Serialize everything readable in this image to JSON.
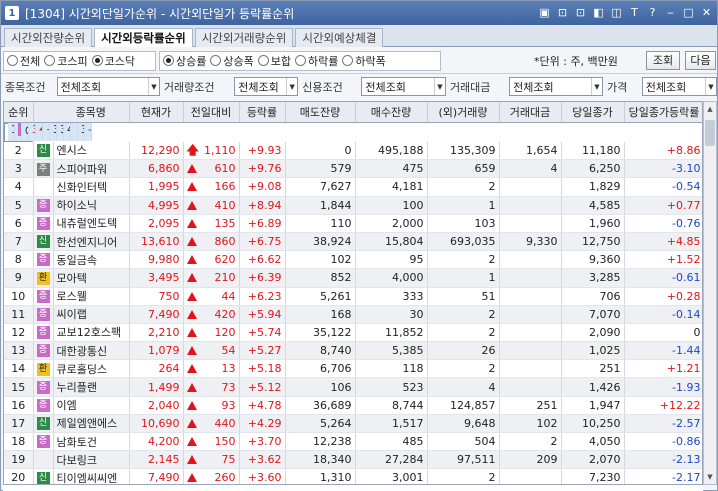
{
  "window": {
    "num": "1",
    "title": "[1304] 시간외단일가순위 - 시간외단일가 등락률순위",
    "tools": [
      "▣",
      "⊡",
      "⊡",
      "◧",
      "◫",
      "T",
      "?",
      "‒",
      "□",
      "✕"
    ]
  },
  "tabs": [
    "시간외잔량순위",
    "시간외등락률순위",
    "시간외거래량순위",
    "시간외예상체결"
  ],
  "active_tab": 1,
  "market_radios": [
    {
      "label": "전체",
      "on": false
    },
    {
      "label": "코스피",
      "on": false
    },
    {
      "label": "코스닥",
      "on": true
    }
  ],
  "change_radios": [
    {
      "label": "상승률",
      "on": true
    },
    {
      "label": "상승폭",
      "on": false
    },
    {
      "label": "보합",
      "on": false
    },
    {
      "label": "하락률",
      "on": false
    },
    {
      "label": "하락폭",
      "on": false
    }
  ],
  "unit_text": "*단위 : 주, 백만원",
  "buttons": {
    "query": "조회",
    "next": "다음"
  },
  "filters": [
    {
      "label": "종목조건",
      "value": "전체조회"
    },
    {
      "label": "거래량조건",
      "value": "전체조회"
    },
    {
      "label": "신용조건",
      "value": "전체조회"
    },
    {
      "label": "거래대금",
      "value": "전체조회"
    },
    {
      "label": "가격",
      "value": "전체조회"
    }
  ],
  "columns": [
    "순위",
    "",
    "종목명",
    "현재가",
    "전일대비",
    "등락률",
    "매도잔량",
    "매수잔량",
    "(외)거래량",
    "거래대금",
    "당일종가",
    "당일종가등락률"
  ],
  "rows": [
    {
      "rank": "1",
      "badge": "증",
      "badge_color": "pink",
      "name": "에프엔씨엔터",
      "price": "3,475",
      "sign": "limit",
      "diff": "315",
      "rate": "+9.97",
      "ask": "398",
      "bid": "301",
      "vol": "4",
      "amt": "",
      "close": "3,160",
      "close_rate": "-1.56",
      "close_dir": "dn"
    },
    {
      "rank": "2",
      "badge": "신",
      "badge_color": "green",
      "name": "엔시스",
      "price": "12,290",
      "sign": "limit",
      "diff": "1,110",
      "rate": "+9.93",
      "ask": "0",
      "bid": "495,188",
      "vol": "135,309",
      "amt": "1,654",
      "close": "11,180",
      "close_rate": "+8.86",
      "close_dir": "up"
    },
    {
      "rank": "3",
      "badge": "주",
      "badge_color": "gray",
      "name": "스피어파워",
      "price": "6,860",
      "sign": "up",
      "diff": "610",
      "rate": "+9.76",
      "ask": "579",
      "bid": "475",
      "vol": "659",
      "amt": "4",
      "close": "6,250",
      "close_rate": "-3.10",
      "close_dir": "dn"
    },
    {
      "rank": "4",
      "badge": "",
      "badge_color": "",
      "name": "신화인터텍",
      "price": "1,995",
      "sign": "up",
      "diff": "166",
      "rate": "+9.08",
      "ask": "7,627",
      "bid": "4,181",
      "vol": "2",
      "amt": "",
      "close": "1,829",
      "close_rate": "-0.54",
      "close_dir": "dn"
    },
    {
      "rank": "5",
      "badge": "증",
      "badge_color": "pink",
      "name": "하이소닉",
      "price": "4,995",
      "sign": "up",
      "diff": "410",
      "rate": "+8.94",
      "ask": "1,844",
      "bid": "100",
      "vol": "1",
      "amt": "",
      "close": "4,585",
      "close_rate": "+0.77",
      "close_dir": "up"
    },
    {
      "rank": "6",
      "badge": "증",
      "badge_color": "pink",
      "name": "내츄럴엔도텍",
      "price": "2,095",
      "sign": "up",
      "diff": "135",
      "rate": "+6.89",
      "ask": "110",
      "bid": "2,000",
      "vol": "103",
      "amt": "",
      "close": "1,960",
      "close_rate": "-0.76",
      "close_dir": "dn"
    },
    {
      "rank": "7",
      "badge": "신",
      "badge_color": "green",
      "name": "한선엔지니어",
      "price": "13,610",
      "sign": "up",
      "diff": "860",
      "rate": "+6.75",
      "ask": "38,924",
      "bid": "15,804",
      "vol": "693,035",
      "amt": "9,330",
      "close": "12,750",
      "close_rate": "+4.85",
      "close_dir": "up"
    },
    {
      "rank": "8",
      "badge": "증",
      "badge_color": "pink",
      "name": "동일금속",
      "price": "9,980",
      "sign": "up",
      "diff": "620",
      "rate": "+6.62",
      "ask": "102",
      "bid": "95",
      "vol": "2",
      "amt": "",
      "close": "9,360",
      "close_rate": "+1.52",
      "close_dir": "up"
    },
    {
      "rank": "9",
      "badge": "환",
      "badge_color": "yellow",
      "name": "모아텍",
      "price": "3,495",
      "sign": "up",
      "diff": "210",
      "rate": "+6.39",
      "ask": "852",
      "bid": "4,000",
      "vol": "1",
      "amt": "",
      "close": "3,285",
      "close_rate": "-0.61",
      "close_dir": "dn"
    },
    {
      "rank": "10",
      "badge": "증",
      "badge_color": "pink",
      "name": "로스웰",
      "price": "750",
      "sign": "up",
      "diff": "44",
      "rate": "+6.23",
      "ask": "5,261",
      "bid": "333",
      "vol": "51",
      "amt": "",
      "close": "706",
      "close_rate": "+0.28",
      "close_dir": "up"
    },
    {
      "rank": "11",
      "badge": "증",
      "badge_color": "pink",
      "name": "씨이랩",
      "price": "7,490",
      "sign": "up",
      "diff": "420",
      "rate": "+5.94",
      "ask": "168",
      "bid": "30",
      "vol": "2",
      "amt": "",
      "close": "7,070",
      "close_rate": "-0.14",
      "close_dir": "dn"
    },
    {
      "rank": "12",
      "badge": "증",
      "badge_color": "pink",
      "name": "교보12호스팩",
      "price": "2,210",
      "sign": "up",
      "diff": "120",
      "rate": "+5.74",
      "ask": "35,122",
      "bid": "11,852",
      "vol": "2",
      "amt": "",
      "close": "2,090",
      "close_rate": "0",
      "close_dir": "flat"
    },
    {
      "rank": "13",
      "badge": "증",
      "badge_color": "pink",
      "name": "대한광통신",
      "price": "1,079",
      "sign": "up",
      "diff": "54",
      "rate": "+5.27",
      "ask": "8,740",
      "bid": "5,385",
      "vol": "26",
      "amt": "",
      "close": "1,025",
      "close_rate": "-1.44",
      "close_dir": "dn"
    },
    {
      "rank": "14",
      "badge": "환",
      "badge_color": "yellow",
      "name": "큐로홀딩스",
      "price": "264",
      "sign": "up",
      "diff": "13",
      "rate": "+5.18",
      "ask": "6,706",
      "bid": "118",
      "vol": "2",
      "amt": "",
      "close": "251",
      "close_rate": "+1.21",
      "close_dir": "up"
    },
    {
      "rank": "15",
      "badge": "증",
      "badge_color": "pink",
      "name": "누리플랜",
      "price": "1,499",
      "sign": "up",
      "diff": "73",
      "rate": "+5.12",
      "ask": "106",
      "bid": "523",
      "vol": "4",
      "amt": "",
      "close": "1,426",
      "close_rate": "-1.93",
      "close_dir": "dn"
    },
    {
      "rank": "16",
      "badge": "증",
      "badge_color": "pink",
      "name": "이엠",
      "price": "2,040",
      "sign": "up",
      "diff": "93",
      "rate": "+4.78",
      "ask": "36,689",
      "bid": "8,744",
      "vol": "124,857",
      "amt": "251",
      "close": "1,947",
      "close_rate": "+12.22",
      "close_dir": "up"
    },
    {
      "rank": "17",
      "badge": "신",
      "badge_color": "green",
      "name": "제일엠앤에스",
      "price": "10,690",
      "sign": "up",
      "diff": "440",
      "rate": "+4.29",
      "ask": "5,264",
      "bid": "1,517",
      "vol": "9,648",
      "amt": "102",
      "close": "10,250",
      "close_rate": "-2.57",
      "close_dir": "dn"
    },
    {
      "rank": "18",
      "badge": "증",
      "badge_color": "pink",
      "name": "남화토건",
      "price": "4,200",
      "sign": "up",
      "diff": "150",
      "rate": "+3.70",
      "ask": "12,238",
      "bid": "485",
      "vol": "504",
      "amt": "2",
      "close": "4,050",
      "close_rate": "-0.86",
      "close_dir": "dn"
    },
    {
      "rank": "19",
      "badge": "",
      "badge_color": "",
      "name": "다보링크",
      "price": "2,145",
      "sign": "up",
      "diff": "75",
      "rate": "+3.62",
      "ask": "18,340",
      "bid": "27,284",
      "vol": "97,511",
      "amt": "209",
      "close": "2,070",
      "close_rate": "-2.13",
      "close_dir": "dn"
    },
    {
      "rank": "20",
      "badge": "신",
      "badge_color": "green",
      "name": "티이엠씨씨엔",
      "price": "7,490",
      "sign": "up",
      "diff": "260",
      "rate": "+3.60",
      "ask": "1,310",
      "bid": "3,001",
      "vol": "2",
      "amt": "",
      "close": "7,230",
      "close_rate": "-2.17",
      "close_dir": "dn"
    }
  ],
  "colors": {
    "up": "#e0141a",
    "down": "#1b46c9",
    "selected_row": "#d4e7f8",
    "title_bar": "#4a6ea8"
  }
}
